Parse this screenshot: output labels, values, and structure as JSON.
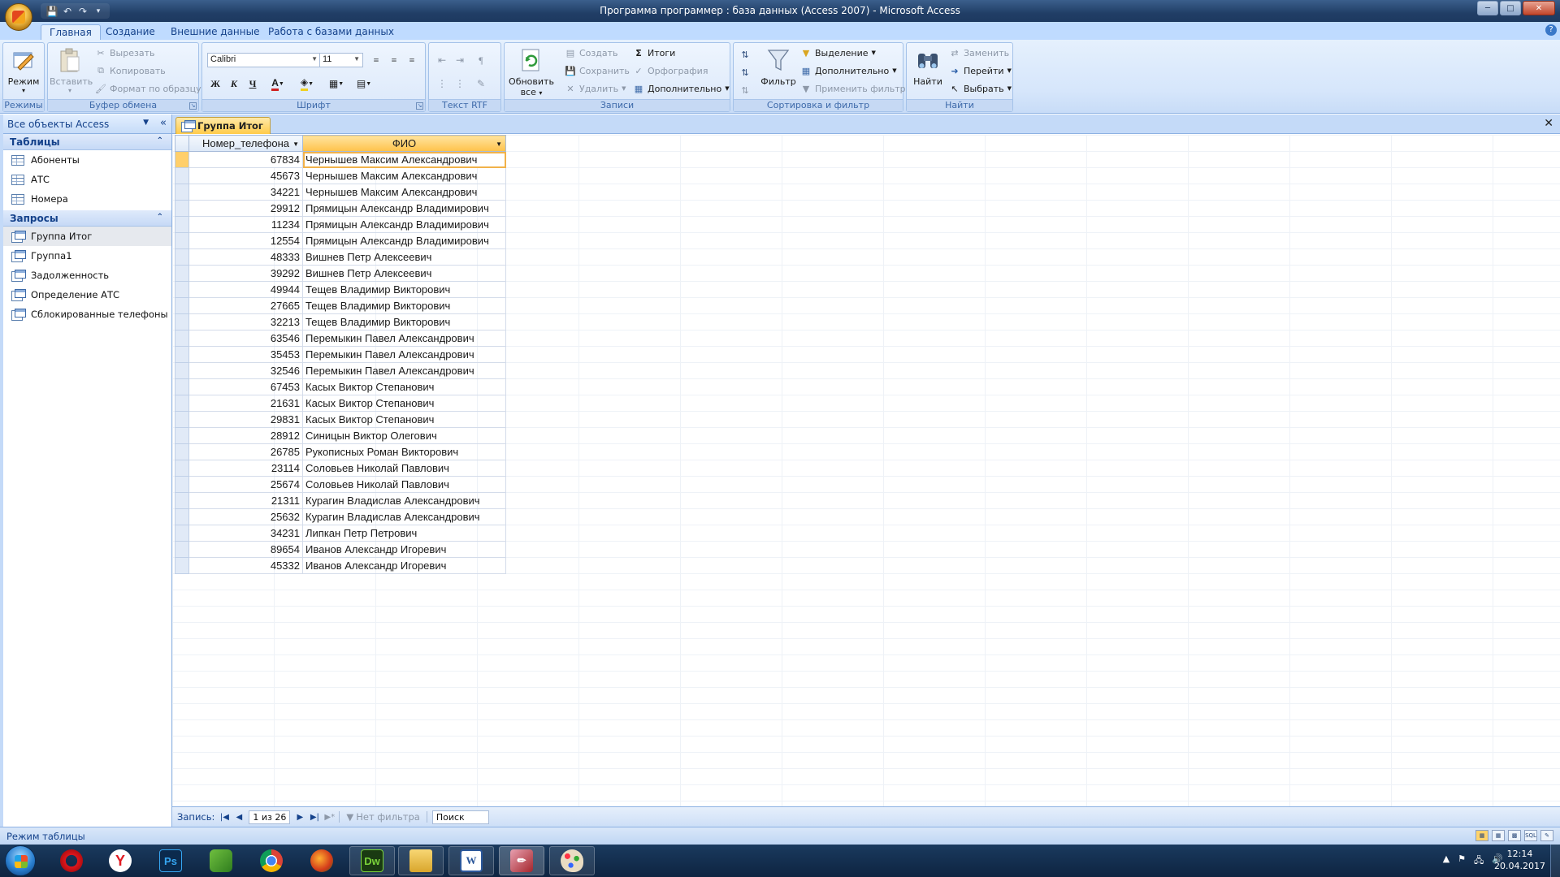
{
  "window": {
    "title": "Программа программер : база данных (Access 2007) - Microsoft Access"
  },
  "ribbon": {
    "tabs": [
      "Главная",
      "Создание",
      "Внешние данные",
      "Работа с базами данных"
    ],
    "active_tab": "Главная",
    "groups": {
      "modes": {
        "label": "Режимы",
        "mode_button": "Режим"
      },
      "clipboard": {
        "label": "Буфер обмена",
        "paste": "Вставить",
        "cut": "Вырезать",
        "copy": "Копировать",
        "format_painter": "Формат по образцу"
      },
      "font": {
        "label": "Шрифт",
        "font_name": "Calibri",
        "font_size": "11",
        "bold": "Ж",
        "italic": "К",
        "underline": "Ч"
      },
      "rtf": {
        "label": "Текст RTF"
      },
      "records": {
        "label": "Записи",
        "refresh": "Обновить",
        "refresh2": "все",
        "new": "Создать",
        "save": "Сохранить",
        "delete": "Удалить",
        "totals": "Итоги",
        "spelling": "Орфография",
        "more": "Дополнительно"
      },
      "sort_filter": {
        "label": "Сортировка и фильтр",
        "filter": "Фильтр",
        "selection": "Выделение",
        "advanced": "Дополнительно",
        "toggle_filter": "Применить фильтр"
      },
      "find": {
        "label": "Найти",
        "find": "Найти",
        "replace": "Заменить",
        "goto": "Перейти",
        "select": "Выбрать"
      }
    }
  },
  "nav_pane": {
    "header": "Все объекты Access",
    "sections": [
      {
        "title": "Таблицы",
        "items": [
          "Абоненты",
          "АТС",
          "Номера"
        ]
      },
      {
        "title": "Запросы",
        "items": [
          "Группа Итог",
          "Группа1",
          "Задолженность",
          "Определение АТС",
          "Сблокированные телефоны"
        ]
      }
    ],
    "selected_item": "Группа Итог"
  },
  "document": {
    "tab_title": "Группа Итог",
    "columns": [
      "Номер_телефона",
      "ФИО"
    ],
    "rows": [
      [
        "67834",
        "Чернышев Максим Александрович"
      ],
      [
        "45673",
        "Чернышев Максим Александрович"
      ],
      [
        "34221",
        "Чернышев Максим Александрович"
      ],
      [
        "29912",
        "Прямицын Александр Владимирович"
      ],
      [
        "11234",
        "Прямицын Александр Владимирович"
      ],
      [
        "12554",
        "Прямицын Александр Владимирович"
      ],
      [
        "48333",
        "Вишнев Петр Алексеевич"
      ],
      [
        "39292",
        "Вишнев Петр Алексеевич"
      ],
      [
        "49944",
        "Тещев Владимир Викторович"
      ],
      [
        "27665",
        "Тещев Владимир Викторович"
      ],
      [
        "32213",
        "Тещев Владимир Викторович"
      ],
      [
        "63546",
        "Перемыкин Павел Александрович"
      ],
      [
        "35453",
        "Перемыкин Павел Александрович"
      ],
      [
        "32546",
        "Перемыкин Павел Александрович"
      ],
      [
        "67453",
        "Касых Виктор Степанович"
      ],
      [
        "21631",
        "Касых Виктор Степанович"
      ],
      [
        "29831",
        "Касых Виктор Степанович"
      ],
      [
        "28912",
        "Синицын Виктор Олегович"
      ],
      [
        "26785",
        "Рукописных Роман Викторович"
      ],
      [
        "23114",
        "Соловьев Николай Павлович"
      ],
      [
        "25674",
        "Соловьев Николай Павлович"
      ],
      [
        "21311",
        "Курагин Владислав Александрович"
      ],
      [
        "25632",
        "Курагин Владислав Александрович"
      ],
      [
        "34231",
        "Липкан Петр Петрович"
      ],
      [
        "89654",
        "Иванов Александр Игоревич"
      ],
      [
        "45332",
        "Иванов Александр Игоревич"
      ]
    ],
    "current_row": 0
  },
  "record_nav": {
    "label": "Запись:",
    "counter": "1 из 26",
    "no_filter": "Нет фильтра",
    "search": "Поиск"
  },
  "status": {
    "text": "Режим таблицы"
  },
  "taskbar": {
    "time": "12:14",
    "date": "20.04.2017",
    "apps": [
      "opera-icon",
      "yandex-icon",
      "photoshop-icon",
      "app-icon",
      "chrome-icon",
      "app2-icon",
      "dreamweaver-icon",
      "explorer-icon",
      "word-icon",
      "access-icon",
      "paint-icon"
    ],
    "labels": {
      "photoshop": "Ps",
      "dreamweaver": "Dw",
      "word": "W"
    }
  },
  "colors": {
    "ribbon_blue": "#bfdbff",
    "title_blue": "#213e66",
    "selected_orange": "#ffc24a"
  }
}
